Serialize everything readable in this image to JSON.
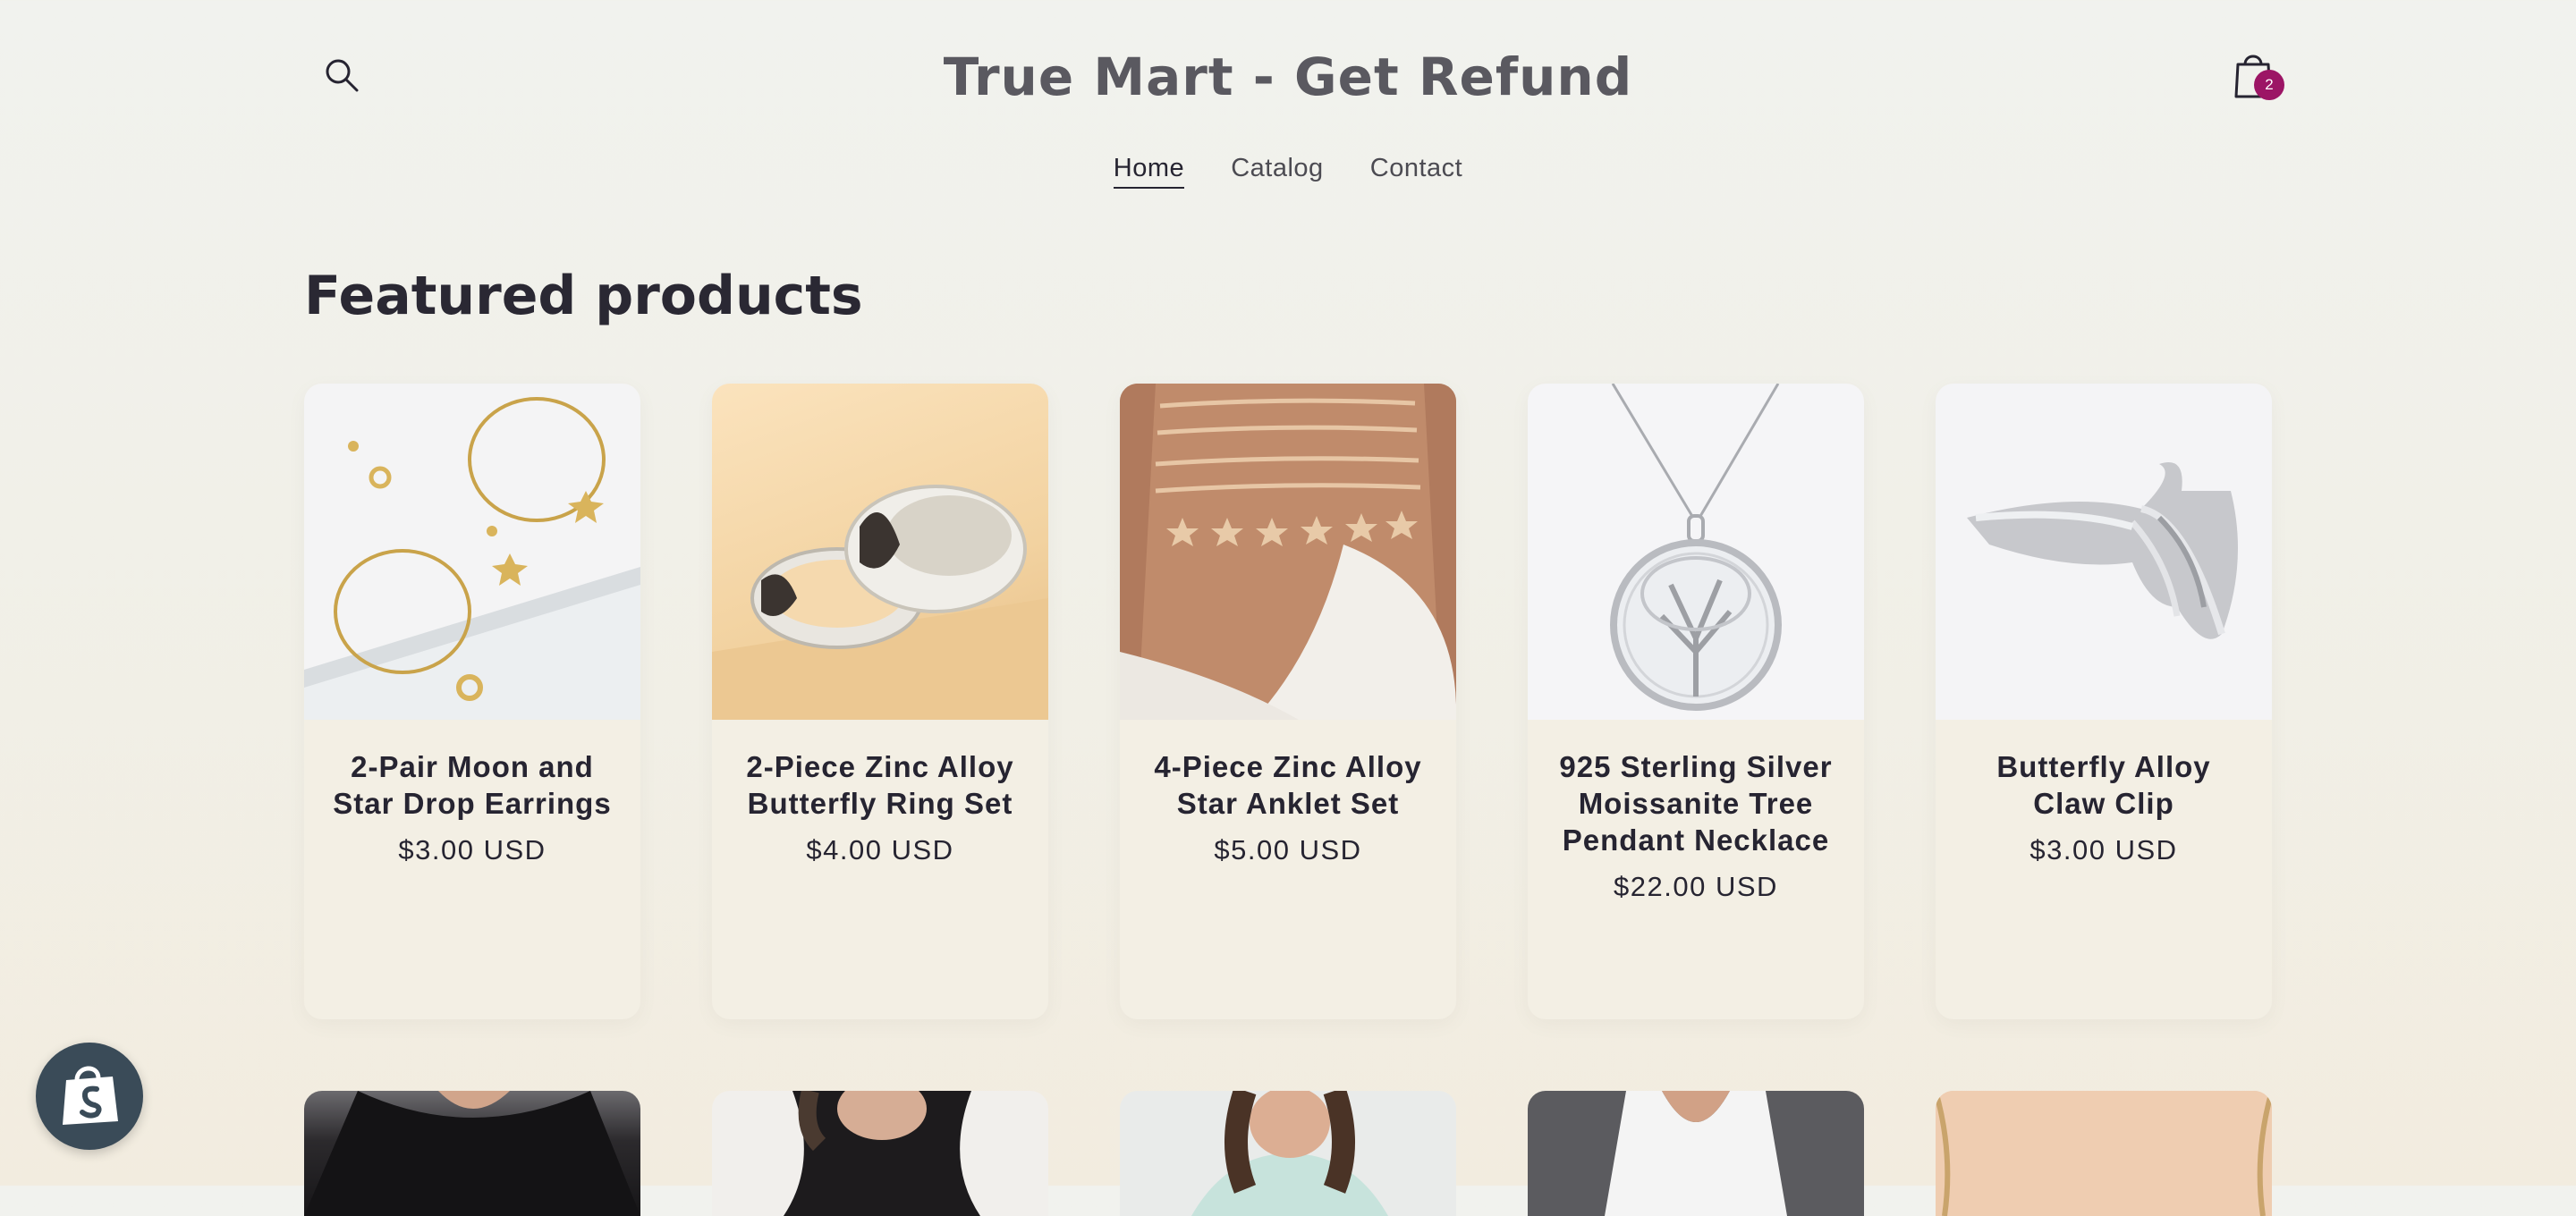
{
  "header": {
    "title": "True Mart - Get Refund",
    "cart_count": "2",
    "nav": [
      {
        "label": "Home",
        "active": true
      },
      {
        "label": "Catalog",
        "active": false
      },
      {
        "label": "Contact",
        "active": false
      }
    ]
  },
  "section": {
    "title": "Featured products"
  },
  "products": [
    {
      "name": "2-Pair Moon and Star Drop Earrings",
      "price": "$3.00 USD"
    },
    {
      "name": "2-Piece Zinc Alloy Butterfly Ring Set",
      "price": "$4.00 USD"
    },
    {
      "name": "4-Piece Zinc Alloy Star Anklet Set",
      "price": "$5.00 USD"
    },
    {
      "name": "925 Sterling Silver Moissanite Tree Pendant Necklace",
      "price": "$22.00 USD"
    },
    {
      "name": "Butterfly Alloy Claw Clip",
      "price": "$3.00 USD"
    }
  ],
  "colors": {
    "accent": "#9c1565",
    "text": "#262431",
    "card_bg": "#f3efe4",
    "shopify_badge": "#3a4b58"
  },
  "icons": {
    "search": "search-icon",
    "cart": "shopping-bag-icon",
    "shopify": "shopify-bag-icon"
  }
}
